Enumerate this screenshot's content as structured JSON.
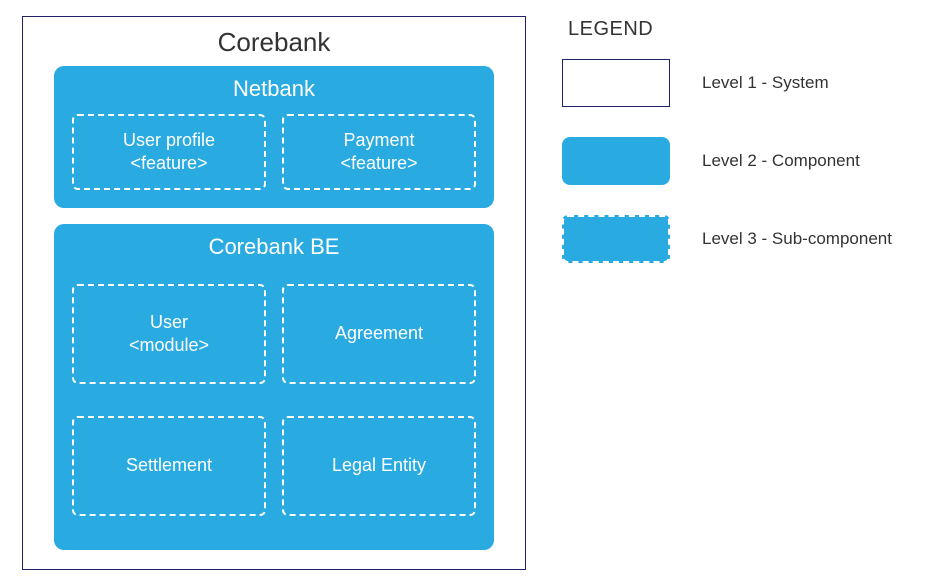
{
  "system": {
    "title": "Corebank"
  },
  "components": {
    "netbank": {
      "title": "Netbank",
      "subs": {
        "user_profile": {
          "line1": "User profile",
          "line2": "<feature>"
        },
        "payment": {
          "line1": "Payment",
          "line2": "<feature>"
        }
      }
    },
    "core_be": {
      "title": "Corebank BE",
      "subs": {
        "user": {
          "line1": "User",
          "line2": "<module>"
        },
        "agreement": {
          "line1": "Agreement"
        },
        "settlement": {
          "line1": "Settlement"
        },
        "legal": {
          "line1": "Legal Entity"
        }
      }
    }
  },
  "legend": {
    "title": "LEGEND",
    "rows": {
      "system": "Level 1 - System",
      "component": "Level 2 - Component",
      "subcomponent": "Level 3 - Sub-component"
    }
  }
}
